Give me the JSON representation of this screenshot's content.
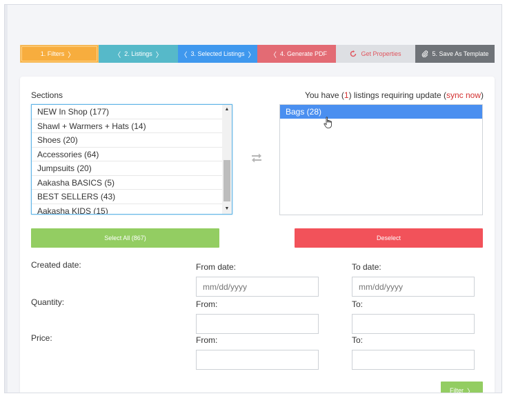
{
  "steps": [
    {
      "label": "1. Filters",
      "chevron_right": "〉"
    },
    {
      "label": "2. Listings",
      "chevron_left": "〈",
      "chevron_right": "〉"
    },
    {
      "label": "3. Selected Listings",
      "chevron_left": "〈",
      "chevron_right": "〉"
    },
    {
      "label": "4. Generate PDF",
      "chevron_left": "〈"
    },
    {
      "label": "Get Properties",
      "icon": "refresh-icon"
    },
    {
      "label": "5. Save As Template",
      "icon": "paperclip-icon"
    }
  ],
  "sections": {
    "title": "Sections",
    "items": [
      "NEW In Shop (177)",
      "Shawl + Warmers + Hats (14)",
      "Shoes (20)",
      "Accessories (64)",
      "Jumpsuits (20)",
      "Aakasha BASICS (5)",
      "BEST SELLERS (43)",
      "Aakasha KIDS (15)"
    ]
  },
  "update_notice": {
    "prefix": "You have (",
    "count": "1",
    "middle": ") listings requiring update (",
    "link": "sync now",
    "suffix": ")"
  },
  "selected": {
    "items": [
      "Bags (28)"
    ]
  },
  "buttons": {
    "select_all": "Select All (867)",
    "deselect": "Deselect",
    "filter": "Filter",
    "filter_chevron": "〉"
  },
  "form": {
    "created_date_label": "Created date:",
    "from_date_label": "From date:",
    "to_date_label": "To date:",
    "from_date_placeholder": "mm/dd/yyyy",
    "to_date_placeholder": "mm/dd/yyyy",
    "quantity_label": "Quantity:",
    "quantity_from_label": "From:",
    "quantity_to_label": "To:",
    "price_label": "Price:",
    "price_from_label": "From:",
    "price_to_label": "To:"
  },
  "colors": {
    "step_filters": "#f7ad3e",
    "step_listings": "#56b9c9",
    "step_selected": "#3f98ee",
    "step_pdf": "#e36b74",
    "step_properties": "#dddfe3",
    "step_template": "#6f7378",
    "select_all": "#93cd62",
    "deselect": "#f2525a",
    "selected_item": "#4a8ff0",
    "accent_red": "#d32f2f"
  }
}
